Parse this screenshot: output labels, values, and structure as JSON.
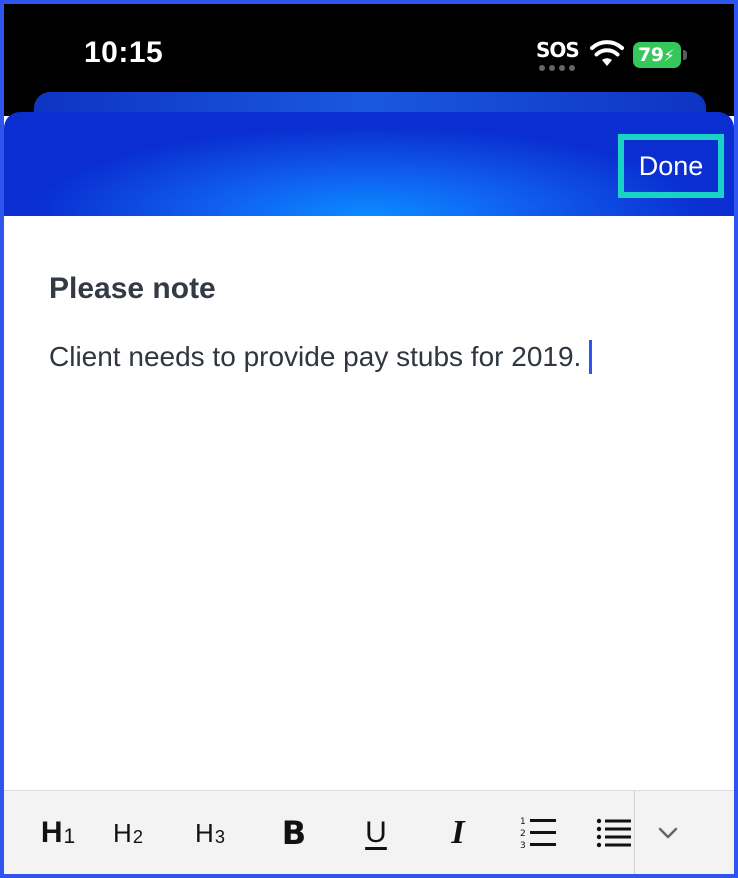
{
  "status_bar": {
    "time": "10:15",
    "sos": "SOS",
    "battery": "79",
    "icons": [
      "wifi-icon",
      "battery-charging-icon"
    ]
  },
  "header": {
    "done_label": "Done",
    "accent_color": "#19d4c4"
  },
  "editor": {
    "title": "Please note",
    "body": "Client needs to provide pay stubs for 2019."
  },
  "toolbar": {
    "h1": {
      "letter": "H",
      "level": "1"
    },
    "h2": {
      "letter": "H",
      "level": "2"
    },
    "h3": {
      "letter": "H",
      "level": "3"
    },
    "bold": "B",
    "underline": "U",
    "italic": "I",
    "icons": [
      "numbered-list-icon",
      "bulleted-list-icon",
      "chevron-down-icon"
    ]
  },
  "colors": {
    "header_blue": "#1060f0",
    "frame_blue": "#2f55f0",
    "battery_green": "#35c759"
  }
}
